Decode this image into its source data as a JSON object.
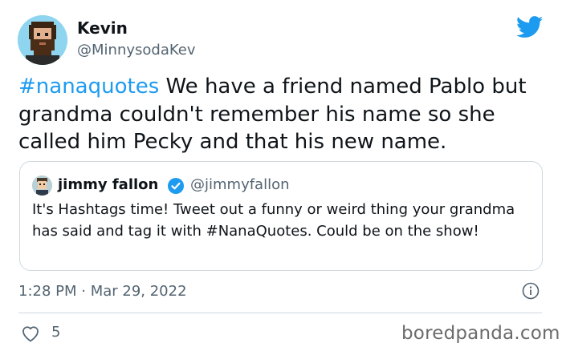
{
  "author": {
    "name": "Kevin",
    "handle": "@MinnysodaKev",
    "avatar_icon": "pixel-art-avatar-icon"
  },
  "brand_icon": "twitter-bird-icon",
  "brand_color": "#1d9bf0",
  "tweet": {
    "hashtag": "#nanaquotes",
    "text": " We have a friend named Pablo but grandma couldn't remember his name so she called him Pecky and that his new name."
  },
  "quoted": {
    "name": "jimmy fallon",
    "handle": "@jimmyfallon",
    "verified_icon": "verified-badge-icon",
    "text": "It's Hashtags time! Tweet out a funny or weird thing your grandma has said and tag it with #NanaQuotes. Could be on the show!"
  },
  "meta": {
    "time": "1:28 PM",
    "separator": " · ",
    "date": "Mar 29, 2022"
  },
  "likes": {
    "count": "5",
    "icon": "heart-icon"
  },
  "watermark": "boredpanda.com"
}
